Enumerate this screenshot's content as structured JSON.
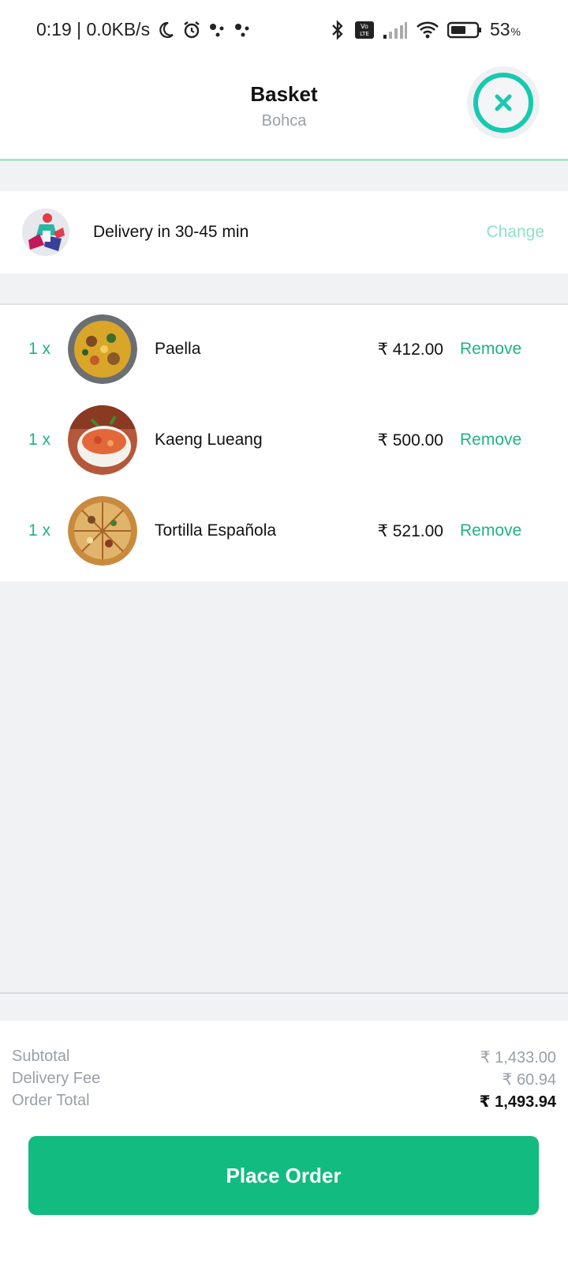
{
  "status_bar": {
    "time_info": "0:19 | 0.0KB/s",
    "battery": "53",
    "battery_symbol": "%",
    "icons_left": [
      "moon-icon",
      "alarm-icon",
      "assistant-dots-icon",
      "assistant-dots-icon"
    ],
    "icons_right": [
      "bluetooth-icon",
      "volte-icon",
      "signal-icon",
      "wifi-icon",
      "battery-icon"
    ]
  },
  "header": {
    "title": "Basket",
    "subtitle": "Bohca",
    "close_icon": "close-icon"
  },
  "delivery": {
    "text": "Delivery in 30-45 min",
    "change_label": "Change"
  },
  "items": [
    {
      "qty": "1 x",
      "name": "Paella",
      "price": "₹ 412.00",
      "remove_label": "Remove"
    },
    {
      "qty": "1 x",
      "name": "Kaeng Lueang",
      "price": "₹ 500.00",
      "remove_label": "Remove"
    },
    {
      "qty": "1 x",
      "name": "Tortilla Española",
      "price": "₹ 521.00",
      "remove_label": "Remove"
    }
  ],
  "summary": {
    "subtotal_label": "Subtotal",
    "subtotal_value": "₹ 1,433.00",
    "delivery_fee_label": "Delivery Fee",
    "delivery_fee_value": "₹ 60.94",
    "order_total_label": "Order Total",
    "order_total_value": "₹ 1,493.94"
  },
  "place_order_label": "Place Order",
  "colors": {
    "accent_green": "#12bb7f",
    "link_green": "#1fb381",
    "close_ring": "#16c9b0"
  }
}
